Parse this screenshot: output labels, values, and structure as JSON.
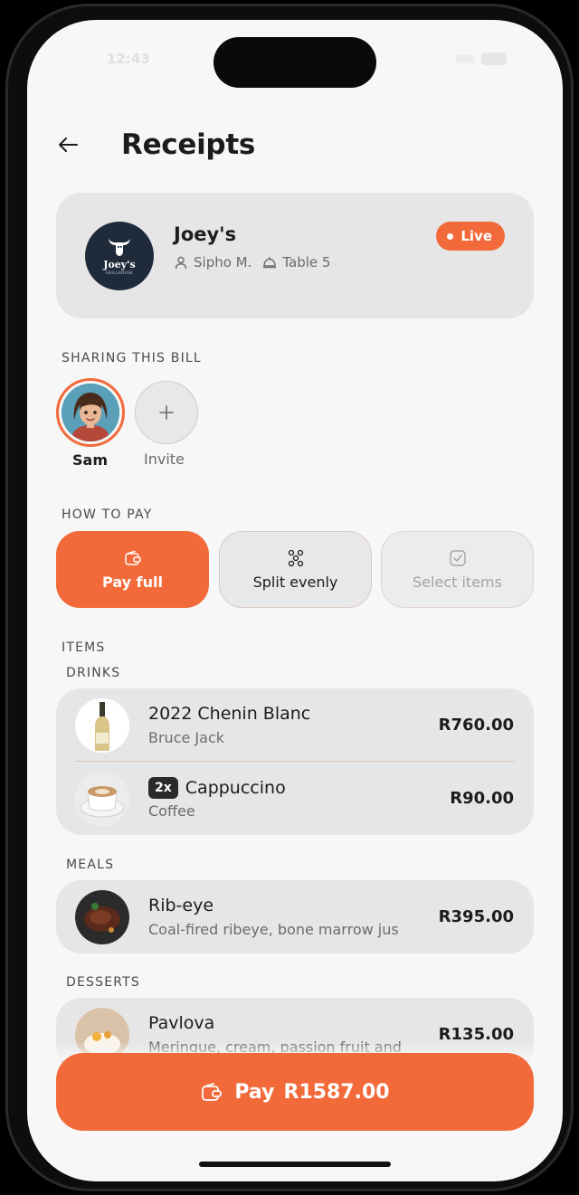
{
  "status": {
    "time": "12:43"
  },
  "header": {
    "title": "Receipts"
  },
  "venue": {
    "name": "Joey's",
    "logo_text": "Joey's",
    "logo_sub": "GRILLHOUSE",
    "waiter": "Sipho M.",
    "table": "Table 5",
    "status": "Live"
  },
  "sharing": {
    "label": "SHARING THIS BILL",
    "people": [
      {
        "name": "Sam"
      }
    ],
    "invite_label": "Invite"
  },
  "payment": {
    "label": "HOW TO PAY",
    "options": [
      {
        "label": "Pay full",
        "icon": "wallet-icon",
        "state": "selected"
      },
      {
        "label": "Split evenly",
        "icon": "split-icon",
        "state": "default"
      },
      {
        "label": "Select items",
        "icon": "checkbox-icon",
        "state": "disabled"
      }
    ]
  },
  "items": {
    "label": "ITEMS",
    "groups": [
      {
        "label": "DRINKS",
        "items": [
          {
            "name": "2022 Chenin Blanc",
            "sub": "Bruce Jack",
            "price": "R760.00",
            "qty": ""
          },
          {
            "name": "Cappuccino",
            "sub": "Coffee",
            "price": "R90.00",
            "qty": "2x"
          }
        ]
      },
      {
        "label": "MEALS",
        "items": [
          {
            "name": "Rib-eye",
            "sub": "Coal-fired ribeye, bone marrow jus",
            "price": "R395.00",
            "qty": ""
          }
        ]
      },
      {
        "label": "DESSERTS",
        "items": [
          {
            "name": "Pavlova",
            "sub": "Meringue, cream, passion fruit and",
            "price": "R135.00",
            "qty": ""
          }
        ]
      }
    ]
  },
  "pay_button": {
    "label": "Pay",
    "amount": "R1587.00"
  },
  "colors": {
    "accent": "#f26a3a",
    "card": "#e6e6e6",
    "background": "#f7f7f7"
  }
}
